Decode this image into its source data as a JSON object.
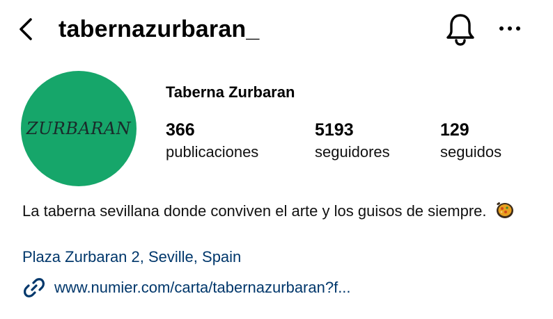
{
  "header": {
    "username": "tabernazurbaran_",
    "back_icon": "chevron-left-icon",
    "bell_icon": "bell-icon",
    "more_icon": "more-horizontal-icon"
  },
  "profile": {
    "avatar_logo_text": "ZURBARAN",
    "avatar_color": "#16a66a",
    "display_name": "Taberna Zurbaran",
    "stats": [
      {
        "value": "366",
        "label": "publicaciones"
      },
      {
        "value": "5193",
        "label": "seguidores"
      },
      {
        "value": "129",
        "label": "seguidos"
      }
    ],
    "bio_text": "La taberna sevillana donde conviven el arte y los guisos de siempre.",
    "bio_emoji": "paella-pan-icon",
    "location": "Plaza Zurbaran 2, Seville, Spain",
    "link_icon": "link-icon",
    "website": "www.numier.com/carta/tabernazurbaran?f...",
    "link_color": "#00376b"
  }
}
